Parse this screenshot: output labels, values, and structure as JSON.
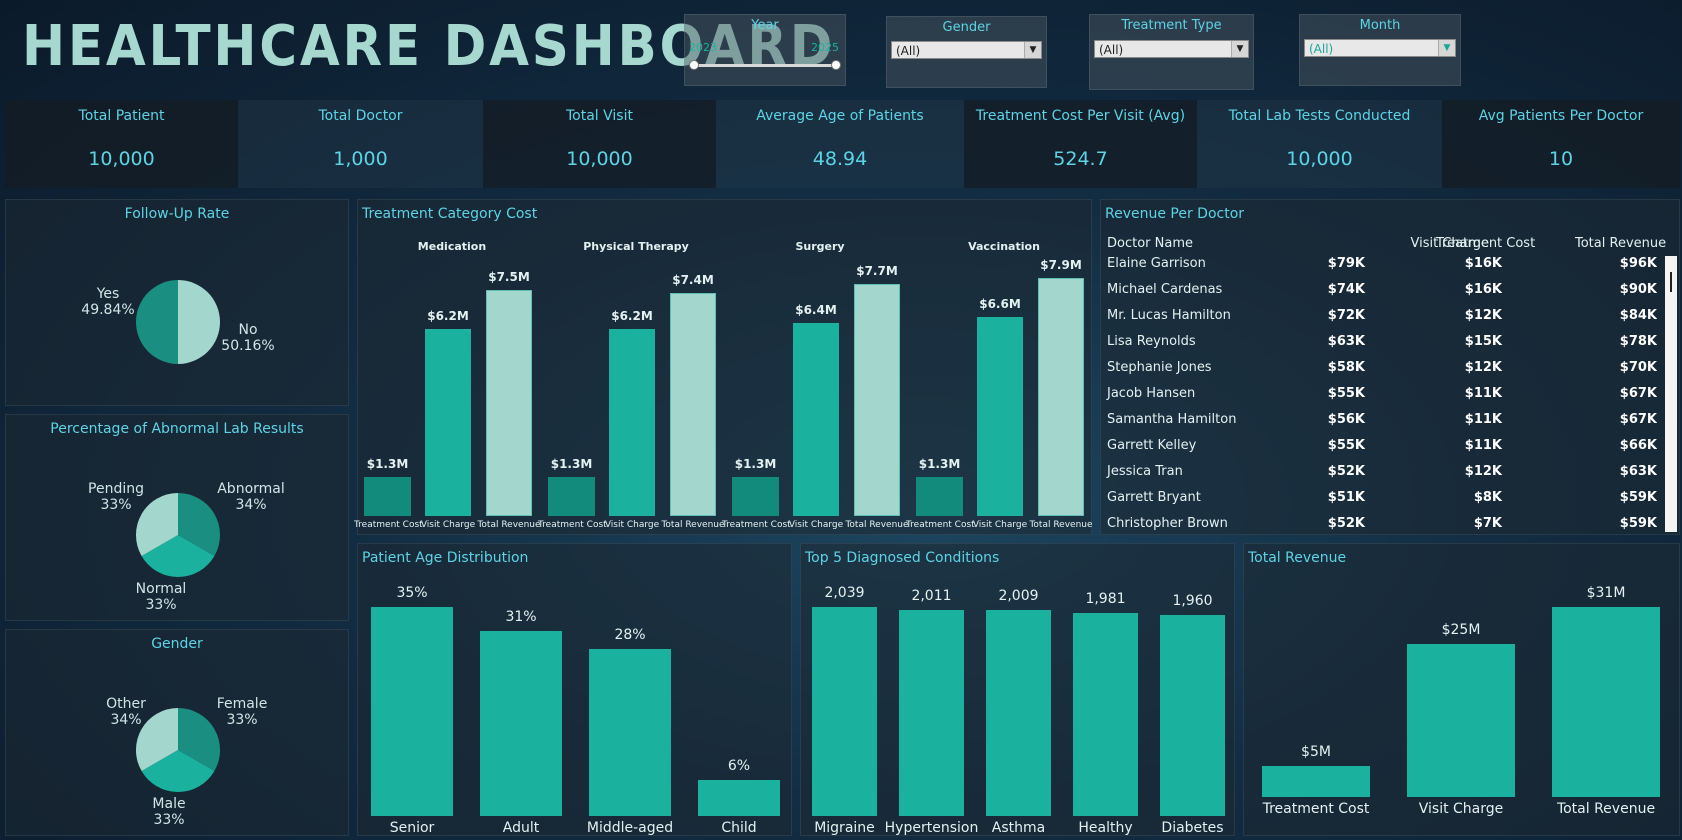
{
  "title": "HEALTHCARE DASHBOARD",
  "filters": {
    "year": {
      "label": "Year",
      "min": "2023",
      "max": "2025"
    },
    "gender": {
      "label": "Gender",
      "value": "(All)"
    },
    "treatment_type": {
      "label": "Treatment Type",
      "value": "(All)"
    },
    "month": {
      "label": "Month",
      "value": "(All)"
    }
  },
  "kpis": [
    {
      "label": "Total Patient",
      "value": "10,000"
    },
    {
      "label": "Total Doctor",
      "value": "1,000"
    },
    {
      "label": "Total Visit",
      "value": "10,000"
    },
    {
      "label": "Average Age of Patients",
      "value": "48.94"
    },
    {
      "label": "Treatment Cost Per Visit (Avg)",
      "value": "524.7"
    },
    {
      "label": "Total Lab Tests Conducted",
      "value": "10,000"
    },
    {
      "label": "Avg Patients Per Doctor",
      "value": "10"
    }
  ],
  "colors": {
    "teal": "#1ab29e",
    "dark_teal": "#128a7c",
    "light_teal": "#a3d6cd",
    "accent": "#5cd4e6"
  },
  "pies": {
    "follow_up": {
      "title": "Follow-Up Rate",
      "slices": [
        {
          "name": "Yes",
          "pct": "49.84%",
          "value": 49.84
        },
        {
          "name": "No",
          "pct": "50.16%",
          "value": 50.16
        }
      ]
    },
    "lab": {
      "title": "Percentage of Abnormal Lab Results",
      "slices": [
        {
          "name": "Abnormal",
          "pct": "34%",
          "value": 34
        },
        {
          "name": "Normal",
          "pct": "33%",
          "value": 33
        },
        {
          "name": "Pending",
          "pct": "33%",
          "value": 33
        }
      ]
    },
    "gender": {
      "title": "Gender",
      "slices": [
        {
          "name": "Female",
          "pct": "33%",
          "value": 33
        },
        {
          "name": "Male",
          "pct": "33%",
          "value": 33
        },
        {
          "name": "Other",
          "pct": "34%",
          "value": 34
        }
      ]
    }
  },
  "treatment_chart": {
    "title": "Treatment Category Cost",
    "groups": [
      {
        "name": "Medication",
        "bars": [
          {
            "x": "Treatment Cost",
            "value": 1.3,
            "label": "$1.3M"
          },
          {
            "x": "Visit Charge",
            "value": 6.2,
            "label": "$6.2M"
          },
          {
            "x": "Total Revenue",
            "value": 7.5,
            "label": "$7.5M"
          }
        ]
      },
      {
        "name": "Physical Therapy",
        "bars": [
          {
            "x": "Treatment Cost",
            "value": 1.3,
            "label": "$1.3M"
          },
          {
            "x": "Visit Charge",
            "value": 6.2,
            "label": "$6.2M"
          },
          {
            "x": "Total Revenue",
            "value": 7.4,
            "label": "$7.4M"
          }
        ]
      },
      {
        "name": "Surgery",
        "bars": [
          {
            "x": "Treatment Cost",
            "value": 1.3,
            "label": "$1.3M"
          },
          {
            "x": "Visit Charge",
            "value": 6.4,
            "label": "$6.4M"
          },
          {
            "x": "Total Revenue",
            "value": 7.7,
            "label": "$7.7M"
          }
        ]
      },
      {
        "name": "Vaccination",
        "bars": [
          {
            "x": "Treatment Cost",
            "value": 1.3,
            "label": "$1.3M"
          },
          {
            "x": "Visit Charge",
            "value": 6.6,
            "label": "$6.6M"
          },
          {
            "x": "Total Revenue",
            "value": 7.9,
            "label": "$7.9M"
          }
        ]
      }
    ]
  },
  "revenue_table": {
    "title": "Revenue Per Doctor",
    "columns": [
      "Doctor Name",
      "Visit Charge",
      "Treatment Cost",
      "Total Revenue"
    ],
    "rows": [
      [
        "Elaine Garrison",
        "$79K",
        "$16K",
        "$96K"
      ],
      [
        "Michael Cardenas",
        "$74K",
        "$16K",
        "$90K"
      ],
      [
        "Mr. Lucas Hamilton",
        "$72K",
        "$12K",
        "$84K"
      ],
      [
        "Lisa Reynolds",
        "$63K",
        "$15K",
        "$78K"
      ],
      [
        "Stephanie Jones",
        "$58K",
        "$12K",
        "$70K"
      ],
      [
        "Jacob Hansen",
        "$55K",
        "$11K",
        "$67K"
      ],
      [
        "Samantha Hamilton",
        "$56K",
        "$11K",
        "$67K"
      ],
      [
        "Garrett Kelley",
        "$55K",
        "$11K",
        "$66K"
      ],
      [
        "Jessica Tran",
        "$52K",
        "$12K",
        "$63K"
      ],
      [
        "Garrett Bryant",
        "$51K",
        "$8K",
        "$59K"
      ],
      [
        "Christopher Brown",
        "$52K",
        "$7K",
        "$59K"
      ]
    ]
  },
  "chart_data": [
    {
      "type": "bar",
      "title": "Patient Age Distribution",
      "categories": [
        "Senior",
        "Adult",
        "Middle-aged",
        "Child"
      ],
      "values": [
        35,
        31,
        28,
        6
      ],
      "labels": [
        "35%",
        "31%",
        "28%",
        "6%"
      ]
    },
    {
      "type": "bar",
      "title": "Top 5 Diagnosed Conditions",
      "categories": [
        "Migraine",
        "Hypertension",
        "Asthma",
        "Healthy",
        "Diabetes"
      ],
      "values": [
        2039,
        2011,
        2009,
        1981,
        1960
      ],
      "labels": [
        "2,039",
        "2,011",
        "2,009",
        "1,981",
        "1,960"
      ]
    },
    {
      "type": "bar",
      "title": "Total Revenue",
      "categories": [
        "Treatment Cost",
        "Visit Charge",
        "Total Revenue"
      ],
      "values": [
        5,
        25,
        31
      ],
      "labels": [
        "$5M",
        "$25M",
        "$31M"
      ]
    }
  ]
}
